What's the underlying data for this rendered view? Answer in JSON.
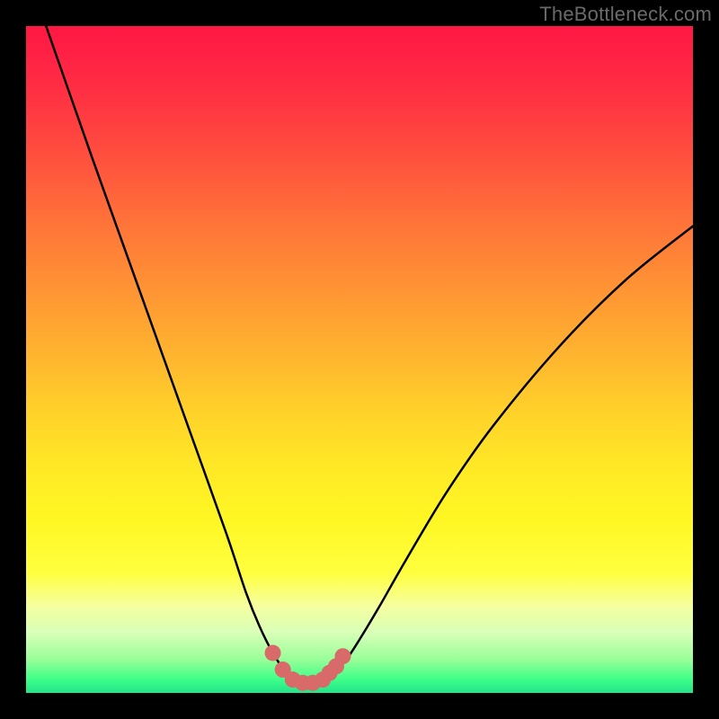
{
  "watermark": "TheBottleneck.com",
  "chart_data": {
    "type": "line",
    "title": "",
    "xlabel": "",
    "ylabel": "",
    "xlim": [
      0,
      100
    ],
    "ylim": [
      0,
      100
    ],
    "series": [
      {
        "name": "bottleneck-curve",
        "x": [
          3,
          10,
          15,
          20,
          25,
          30,
          33,
          35,
          37,
          39,
          40,
          41,
          42,
          44,
          46,
          48,
          50,
          53,
          57,
          63,
          70,
          80,
          90,
          100
        ],
        "values": [
          100,
          80,
          66,
          52,
          38,
          24,
          15,
          10,
          6,
          3,
          2,
          1.5,
          1.5,
          2,
          3,
          5,
          8,
          13,
          20,
          30,
          40,
          52,
          62,
          70
        ]
      }
    ],
    "markers": {
      "name": "highlight-dots",
      "color": "#d86a6a",
      "x": [
        37,
        38.5,
        40,
        41.5,
        43,
        44.5,
        45.5,
        46.5,
        47.5
      ],
      "values": [
        6,
        3.5,
        2,
        1.5,
        1.5,
        2,
        3,
        4,
        5.5
      ],
      "radius": [
        9,
        9,
        9,
        9,
        9,
        9,
        9,
        9,
        9
      ]
    }
  }
}
